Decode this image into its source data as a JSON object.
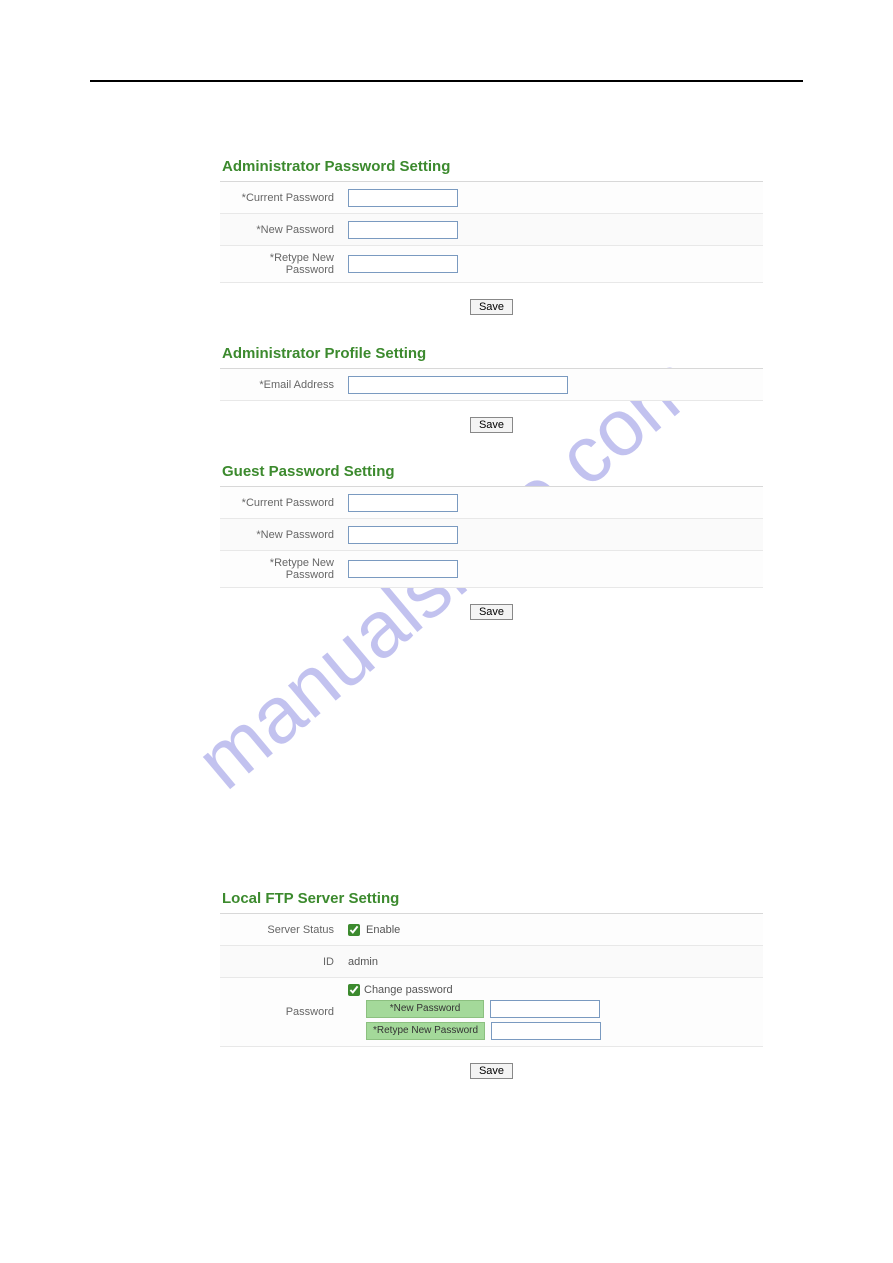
{
  "watermark": "manualshive.com",
  "top_link": "",
  "sections": {
    "admin_pw": {
      "title": "Administrator Password Setting",
      "rows": {
        "current": "*Current Password",
        "new": "*New Password",
        "retype": "*Retype New Password"
      },
      "save": "Save"
    },
    "admin_profile": {
      "title": "Administrator Profile Setting",
      "rows": {
        "email": "*Email Address"
      },
      "save": "Save"
    },
    "guest_pw": {
      "title": "Guest Password Setting",
      "rows": {
        "current": "*Current Password",
        "new": "*New Password",
        "retype": "*Retype New Password"
      },
      "save": "Save"
    },
    "ftp": {
      "title": "Local FTP Server Setting",
      "server_status_label": "Server Status",
      "enable": "Enable",
      "id_label": "ID",
      "id_value": "admin",
      "password_label": "Password",
      "change_pw": "Change password",
      "new_pw": "*New Password",
      "retype_pw": "*Retype New Password",
      "save": "Save"
    }
  }
}
